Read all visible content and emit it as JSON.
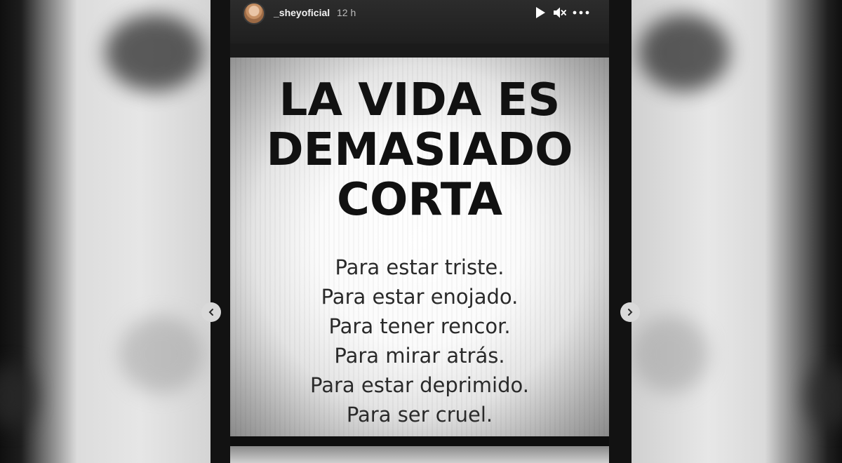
{
  "story": {
    "username": "_sheyoficial",
    "timestamp": "12 h",
    "controls": {
      "play_icon": "play-icon",
      "mute_icon": "speaker-muted-icon",
      "more_icon": "more-dots-icon"
    }
  },
  "poster": {
    "title_lines": [
      "LA VIDA ES",
      "DEMASIADO",
      "CORTA"
    ],
    "lines": [
      "Para estar triste.",
      "Para estar enojado.",
      "Para tener rencor.",
      "Para mirar atrás.",
      "Para estar deprimido.",
      "Para ser cruel."
    ]
  },
  "navigation": {
    "prev_icon": "chevron-left-icon",
    "next_icon": "chevron-right-icon"
  }
}
